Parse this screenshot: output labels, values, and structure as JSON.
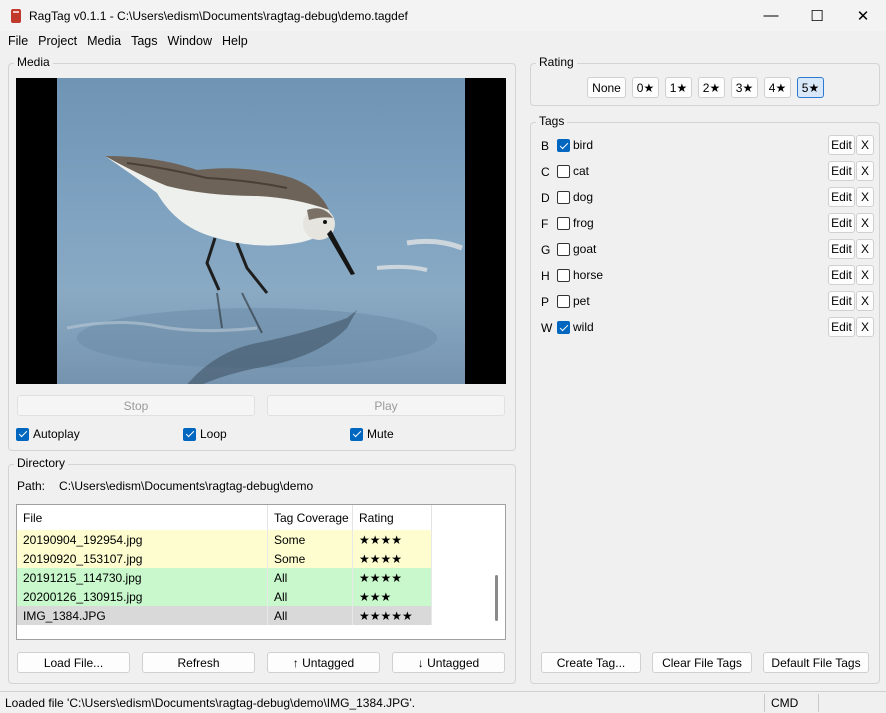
{
  "window": {
    "title": "RagTag v0.1.1 - C:\\Users\\edism\\Documents\\ragtag-debug\\demo.tagdef",
    "minimize": "—",
    "maximize": "☐",
    "close": "✕"
  },
  "menu": [
    "File",
    "Project",
    "Media",
    "Tags",
    "Window",
    "Help"
  ],
  "media": {
    "label": "Media",
    "stop": "Stop",
    "play": "Play",
    "autoplay": {
      "label": "Autoplay",
      "checked": true
    },
    "loop": {
      "label": "Loop",
      "checked": true
    },
    "mute": {
      "label": "Mute",
      "checked": true
    }
  },
  "directory": {
    "label": "Directory",
    "path_label": "Path:",
    "path": "C:\\Users\\edism\\Documents\\ragtag-debug\\demo",
    "columns": [
      "File",
      "Tag Coverage",
      "Rating"
    ],
    "rows": [
      {
        "file": "20190904_192954.jpg",
        "coverage": "Some",
        "rating": "★★★★",
        "bg": "#fdfdd0"
      },
      {
        "file": "20190920_153107.jpg",
        "coverage": "Some",
        "rating": "★★★★",
        "bg": "#fdfdd0"
      },
      {
        "file": "20191215_114730.jpg",
        "coverage": "All",
        "rating": "★★★★",
        "bg": "#c8f8cc"
      },
      {
        "file": "20200126_130915.jpg",
        "coverage": "All",
        "rating": "★★★",
        "bg": "#c8f8cc"
      },
      {
        "file": "IMG_1384.JPG",
        "coverage": "All",
        "rating": "★★★★★",
        "bg": "#d9d9d9"
      }
    ],
    "buttons": {
      "load": "Load File...",
      "refresh": "Refresh",
      "prev": "↑ Untagged",
      "next": "↓ Untagged"
    }
  },
  "rating": {
    "label": "Rating",
    "options": [
      "None",
      "0★",
      "1★",
      "2★",
      "3★",
      "4★",
      "5★"
    ],
    "selected": "5★"
  },
  "tags": {
    "label": "Tags",
    "edit_label": "Edit",
    "delete_label": "X",
    "items": [
      {
        "key": "B",
        "name": "bird",
        "checked": true
      },
      {
        "key": "C",
        "name": "cat",
        "checked": false
      },
      {
        "key": "D",
        "name": "dog",
        "checked": false
      },
      {
        "key": "F",
        "name": "frog",
        "checked": false
      },
      {
        "key": "G",
        "name": "goat",
        "checked": false
      },
      {
        "key": "H",
        "name": "horse",
        "checked": false
      },
      {
        "key": "P",
        "name": "pet",
        "checked": false
      },
      {
        "key": "W",
        "name": "wild",
        "checked": true
      }
    ],
    "buttons": {
      "create": "Create Tag...",
      "clear": "Clear File Tags",
      "default": "Default File Tags"
    }
  },
  "status": {
    "message": "Loaded file 'C:\\Users\\edism\\Documents\\ragtag-debug\\demo\\IMG_1384.JPG'.",
    "mode": "CMD"
  },
  "colors": {
    "accent": "#0067c0",
    "selected_rating": "#d9e8f8"
  }
}
